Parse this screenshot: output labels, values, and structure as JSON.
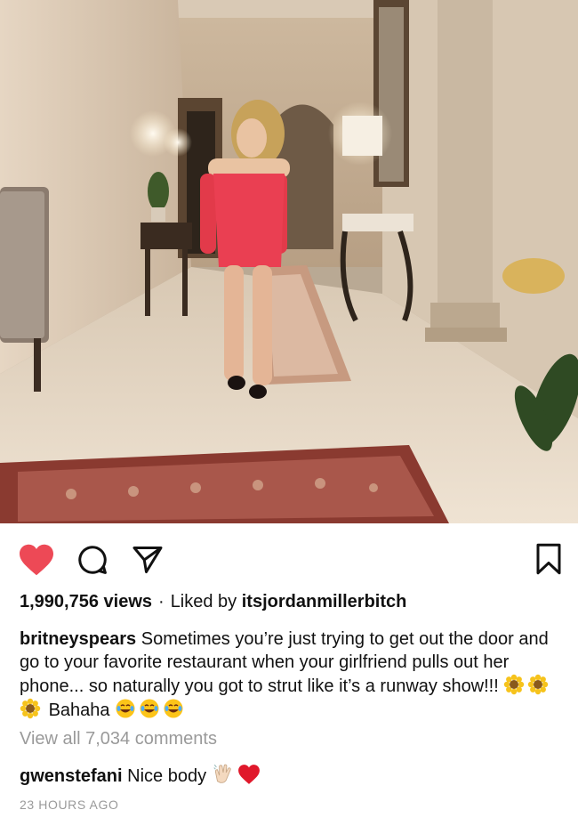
{
  "video": {
    "alt": "Woman in red off-shoulder dress walking down a hallway"
  },
  "actions": {
    "heart_icon": "heart-filled",
    "heart_color": "#ed4956",
    "comment_icon": "comment",
    "share_icon": "paper-plane",
    "bookmark_icon": "bookmark"
  },
  "stats": {
    "views": "1,990,756 views",
    "separator": "·",
    "liked_prefix": "Liked by",
    "liked_user": "itsjordanmillerbitch"
  },
  "caption": {
    "username": "britneyspears",
    "text": "Sometimes you’re just trying to get out the door and go to your favorite restaurant when your girlfriend pulls out her phone... so naturally you got to strut like it’s a runway show!!!",
    "after_flowers": "Bahaha",
    "flower_emoji": "sunflower",
    "laugh_emoji": "tears-of-joy"
  },
  "comments": {
    "view_all": "View all 7,034 comments",
    "top": {
      "username": "gwenstefani",
      "text": "Nice body",
      "emojis": [
        "clapping-hands",
        "red-heart"
      ]
    }
  },
  "timestamp": "23 HOURS AGO"
}
